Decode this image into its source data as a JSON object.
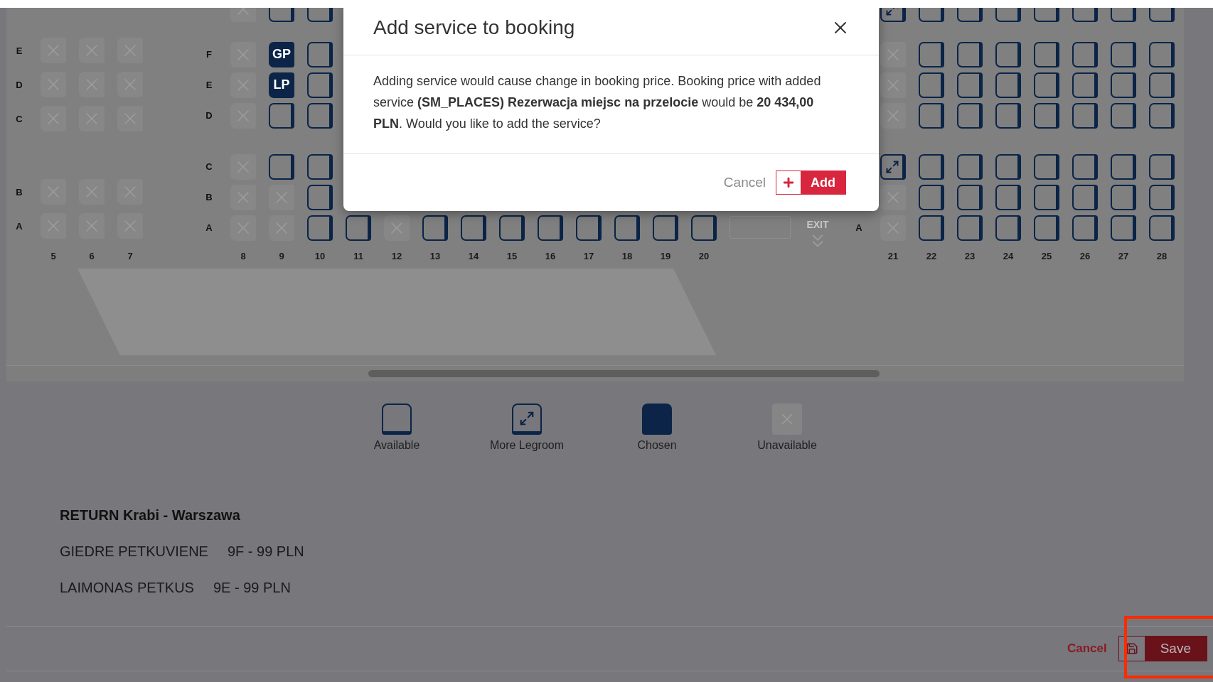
{
  "seat_map": {
    "sections": [
      {
        "rows": [
          {
            "kind": "seats",
            "letter": "E",
            "seats": [
              {
                "kind": "unavailable"
              },
              {
                "kind": "unavailable"
              },
              {
                "kind": "unavailable"
              }
            ]
          },
          {
            "kind": "seats",
            "letter": "D",
            "seats": [
              {
                "kind": "unavailable"
              },
              {
                "kind": "unavailable"
              },
              {
                "kind": "unavailable"
              }
            ]
          },
          {
            "kind": "seats",
            "letter": "C",
            "seats": [
              {
                "kind": "unavailable"
              },
              {
                "kind": "unavailable"
              },
              {
                "kind": "unavailable"
              }
            ]
          },
          {
            "kind": "aisle"
          },
          {
            "kind": "seats",
            "letter": "B",
            "seats": [
              {
                "kind": "unavailable"
              },
              {
                "kind": "unavailable"
              },
              {
                "kind": "unavailable"
              }
            ]
          },
          {
            "kind": "seats",
            "letter": "A",
            "seats": [
              {
                "kind": "unavailable"
              },
              {
                "kind": "unavailable"
              },
              {
                "kind": "unavailable"
              }
            ]
          }
        ],
        "columns": [
          "5",
          "6",
          "7"
        ]
      },
      {
        "rows": [
          {
            "kind": "seats",
            "seats": [
              {
                "kind": "unavailable"
              },
              {
                "kind": "available"
              },
              {
                "kind": "available"
              }
            ]
          },
          {
            "kind": "aisle"
          },
          {
            "kind": "seats",
            "letter": "F",
            "seats": [
              {
                "kind": "unavailable"
              },
              {
                "kind": "chosen",
                "label": "GP"
              },
              {
                "kind": "available"
              }
            ]
          },
          {
            "kind": "seats",
            "letter": "E",
            "seats": [
              {
                "kind": "unavailable"
              },
              {
                "kind": "chosen",
                "label": "LP"
              },
              {
                "kind": "available"
              }
            ]
          },
          {
            "kind": "seats",
            "letter": "D",
            "seats": [
              {
                "kind": "unavailable"
              },
              {
                "kind": "available"
              },
              {
                "kind": "available"
              }
            ]
          },
          {
            "kind": "aisle"
          },
          {
            "kind": "seats",
            "letter": "C",
            "seats": [
              {
                "kind": "unavailable"
              },
              {
                "kind": "available"
              },
              {
                "kind": "available"
              }
            ]
          },
          {
            "kind": "seats",
            "letter": "B",
            "seats": [
              {
                "kind": "unavailable"
              },
              {
                "kind": "unavailable"
              },
              {
                "kind": "available"
              }
            ]
          },
          {
            "kind": "seats",
            "letter": "A",
            "seats": [
              {
                "kind": "unavailable"
              },
              {
                "kind": "unavailable"
              },
              {
                "kind": "available"
              },
              {
                "kind": "available"
              },
              {
                "kind": "unavailable"
              },
              {
                "kind": "available"
              },
              {
                "kind": "available"
              },
              {
                "kind": "available"
              },
              {
                "kind": "available"
              },
              {
                "kind": "available"
              },
              {
                "kind": "available"
              },
              {
                "kind": "available"
              },
              {
                "kind": "available"
              }
            ]
          }
        ],
        "columns": [
          "8",
          "9",
          "10",
          "11",
          "12",
          "13",
          "14",
          "15",
          "16",
          "17",
          "18",
          "19",
          "20"
        ]
      },
      {
        "rows": [
          {
            "kind": "seats",
            "seats": [
              {
                "kind": "legroom"
              },
              {
                "kind": "available"
              },
              {
                "kind": "available"
              },
              {
                "kind": "available"
              },
              {
                "kind": "available"
              },
              {
                "kind": "available"
              },
              {
                "kind": "available"
              },
              {
                "kind": "available"
              }
            ]
          },
          {
            "kind": "aisle"
          },
          {
            "kind": "seats",
            "seats": [
              {
                "kind": "unavailable"
              },
              {
                "kind": "available"
              },
              {
                "kind": "available"
              },
              {
                "kind": "available"
              },
              {
                "kind": "available"
              },
              {
                "kind": "available"
              },
              {
                "kind": "available"
              },
              {
                "kind": "available"
              }
            ]
          },
          {
            "kind": "seats",
            "seats": [
              {
                "kind": "unavailable"
              },
              {
                "kind": "available"
              },
              {
                "kind": "available"
              },
              {
                "kind": "available"
              },
              {
                "kind": "available"
              },
              {
                "kind": "available"
              },
              {
                "kind": "available"
              },
              {
                "kind": "available"
              }
            ]
          },
          {
            "kind": "seats",
            "seats": [
              {
                "kind": "unavailable"
              },
              {
                "kind": "available"
              },
              {
                "kind": "available"
              },
              {
                "kind": "available"
              },
              {
                "kind": "available"
              },
              {
                "kind": "available"
              },
              {
                "kind": "available"
              },
              {
                "kind": "available"
              }
            ]
          },
          {
            "kind": "aisle"
          },
          {
            "kind": "seats",
            "seats": [
              {
                "kind": "legroom"
              },
              {
                "kind": "available"
              },
              {
                "kind": "available"
              },
              {
                "kind": "available"
              },
              {
                "kind": "available"
              },
              {
                "kind": "available"
              },
              {
                "kind": "available"
              },
              {
                "kind": "available"
              }
            ]
          },
          {
            "kind": "seats",
            "seats": [
              {
                "kind": "unavailable"
              },
              {
                "kind": "available"
              },
              {
                "kind": "available"
              },
              {
                "kind": "available"
              },
              {
                "kind": "available"
              },
              {
                "kind": "available"
              },
              {
                "kind": "available"
              },
              {
                "kind": "available"
              }
            ]
          },
          {
            "kind": "seats",
            "letter": "A",
            "seats": [
              {
                "kind": "unavailable"
              },
              {
                "kind": "available"
              },
              {
                "kind": "available"
              },
              {
                "kind": "available"
              },
              {
                "kind": "available"
              },
              {
                "kind": "available"
              },
              {
                "kind": "available"
              },
              {
                "kind": "available"
              }
            ]
          }
        ],
        "columns": [
          "21",
          "22",
          "23",
          "24",
          "25",
          "26",
          "27",
          "28"
        ]
      }
    ],
    "exit": {
      "label": "EXIT"
    }
  },
  "legend": [
    {
      "kind": "available",
      "label": "Available"
    },
    {
      "kind": "legroom",
      "label": "More Legroom"
    },
    {
      "kind": "chosen",
      "label": "Chosen"
    },
    {
      "kind": "unavailable",
      "label": "Unavailable"
    }
  ],
  "itinerary": {
    "title": "RETURN Krabi - Warszawa",
    "passengers": [
      {
        "name": "GIEDRE PETKUVIENE",
        "seat": "9F - 99 PLN"
      },
      {
        "name": "LAIMONAS PETKUS",
        "seat": "9E - 99 PLN"
      }
    ]
  },
  "footer": {
    "buttons": [
      {
        "kind": "link",
        "label": "Cancel"
      },
      {
        "kind": "primary",
        "label": "Save"
      }
    ]
  },
  "dialog": {
    "title": "Add service to booking",
    "message": "Adding service would cause change in booking price. Booking price with added service **(SM_PLACES) Rezerwacja miejsc na przelocie** would be **20 434,00 PLN**. Would you like to add the service?",
    "buttons": [
      {
        "kind": "secondary",
        "label": "Cancel"
      },
      {
        "kind": "primary",
        "label": "Add"
      }
    ]
  }
}
